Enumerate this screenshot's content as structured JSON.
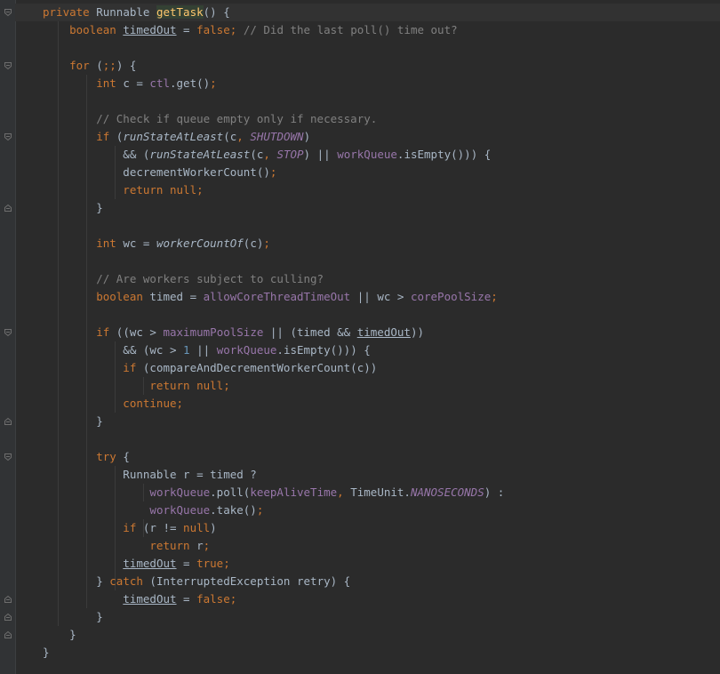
{
  "editor": {
    "lines": [
      [
        {
          "t": "private",
          "c": "kw"
        },
        {
          "t": " Runnable "
        },
        {
          "t": "getTask",
          "c": "fn hl"
        },
        {
          "t": "() {"
        }
      ],
      [
        {
          "t": "    boolean ",
          "c": "kw"
        },
        {
          "t": "timedOut",
          "c": "ul"
        },
        {
          "t": " = "
        },
        {
          "t": "false",
          "c": "kw"
        },
        {
          "t": "; ",
          "c": "kw"
        },
        {
          "t": "// Did the last poll() time out?",
          "c": "cm"
        }
      ],
      [],
      [
        {
          "t": "    for ",
          "c": "kw"
        },
        {
          "t": "("
        },
        {
          "t": ";;",
          "c": "kw"
        },
        {
          "t": ") {"
        }
      ],
      [
        {
          "t": "        int ",
          "c": "kw"
        },
        {
          "t": "c = "
        },
        {
          "t": "ctl",
          "c": "fld"
        },
        {
          "t": ".get()"
        },
        {
          "t": ";",
          "c": "kw"
        }
      ],
      [],
      [
        {
          "t": "        // Check if queue empty only if necessary.",
          "c": "cm"
        }
      ],
      [
        {
          "t": "        if ",
          "c": "kw"
        },
        {
          "t": "("
        },
        {
          "t": "runStateAtLeast",
          "c": "st"
        },
        {
          "t": "(c"
        },
        {
          "t": ", ",
          "c": "kw"
        },
        {
          "t": "SHUTDOWN",
          "c": "cfld"
        },
        {
          "t": ")"
        }
      ],
      [
        {
          "t": "            && ("
        },
        {
          "t": "runStateAtLeast",
          "c": "st"
        },
        {
          "t": "(c"
        },
        {
          "t": ", ",
          "c": "kw"
        },
        {
          "t": "STOP",
          "c": "cfld"
        },
        {
          "t": ") || "
        },
        {
          "t": "workQueue",
          "c": "fld"
        },
        {
          "t": ".isEmpty())) {"
        }
      ],
      [
        {
          "t": "            decrementWorkerCount()"
        },
        {
          "t": ";",
          "c": "kw"
        }
      ],
      [
        {
          "t": "            return null;",
          "c": "kw"
        }
      ],
      [
        {
          "t": "        }"
        }
      ],
      [],
      [
        {
          "t": "        int ",
          "c": "kw"
        },
        {
          "t": "wc = "
        },
        {
          "t": "workerCountOf",
          "c": "st"
        },
        {
          "t": "(c)"
        },
        {
          "t": ";",
          "c": "kw"
        }
      ],
      [],
      [
        {
          "t": "        // Are workers subject to culling?",
          "c": "cm"
        }
      ],
      [
        {
          "t": "        boolean ",
          "c": "kw"
        },
        {
          "t": "timed = "
        },
        {
          "t": "allowCoreThreadTimeOut",
          "c": "fld"
        },
        {
          "t": " || wc > "
        },
        {
          "t": "corePoolSize",
          "c": "fld"
        },
        {
          "t": ";",
          "c": "kw"
        }
      ],
      [],
      [
        {
          "t": "        if ",
          "c": "kw"
        },
        {
          "t": "((wc > "
        },
        {
          "t": "maximumPoolSize",
          "c": "fld"
        },
        {
          "t": " || (timed && "
        },
        {
          "t": "timedOut",
          "c": "ul"
        },
        {
          "t": "))"
        }
      ],
      [
        {
          "t": "            && (wc > "
        },
        {
          "t": "1",
          "c": "num"
        },
        {
          "t": " || "
        },
        {
          "t": "workQueue",
          "c": "fld"
        },
        {
          "t": ".isEmpty())) {"
        }
      ],
      [
        {
          "t": "            if ",
          "c": "kw"
        },
        {
          "t": "(compareAndDecrementWorkerCount(c))"
        }
      ],
      [
        {
          "t": "                return null;",
          "c": "kw"
        }
      ],
      [
        {
          "t": "            continue;",
          "c": "kw"
        }
      ],
      [
        {
          "t": "        }"
        }
      ],
      [],
      [
        {
          "t": "        try ",
          "c": "kw"
        },
        {
          "t": "{"
        }
      ],
      [
        {
          "t": "            Runnable r = timed ?"
        }
      ],
      [
        {
          "t": "                "
        },
        {
          "t": "workQueue",
          "c": "fld"
        },
        {
          "t": ".poll("
        },
        {
          "t": "keepAliveTime",
          "c": "fld"
        },
        {
          "t": ", ",
          "c": "kw"
        },
        {
          "t": "TimeUnit."
        },
        {
          "t": "NANOSECONDS",
          "c": "cfld"
        },
        {
          "t": ") :"
        }
      ],
      [
        {
          "t": "                "
        },
        {
          "t": "workQueue",
          "c": "fld"
        },
        {
          "t": ".take()"
        },
        {
          "t": ";",
          "c": "kw"
        }
      ],
      [
        {
          "t": "            if ",
          "c": "kw"
        },
        {
          "t": "(r != "
        },
        {
          "t": "null",
          "c": "kw"
        },
        {
          "t": ")"
        }
      ],
      [
        {
          "t": "                return ",
          "c": "kw"
        },
        {
          "t": "r"
        },
        {
          "t": ";",
          "c": "kw"
        }
      ],
      [
        {
          "t": "            "
        },
        {
          "t": "timedOut",
          "c": "ul"
        },
        {
          "t": " = "
        },
        {
          "t": "true;",
          "c": "kw"
        }
      ],
      [
        {
          "t": "        } "
        },
        {
          "t": "catch ",
          "c": "kw"
        },
        {
          "t": "(InterruptedException retry) {"
        }
      ],
      [
        {
          "t": "            "
        },
        {
          "t": "timedOut",
          "c": "ul"
        },
        {
          "t": " = "
        },
        {
          "t": "false;",
          "c": "kw"
        }
      ],
      [
        {
          "t": "        }"
        }
      ],
      [
        {
          "t": "    }"
        }
      ],
      [
        {
          "t": "}"
        }
      ]
    ],
    "fold_markers": {
      "open": [
        0,
        3,
        7,
        18,
        25
      ],
      "close": [
        11,
        23,
        33,
        34,
        35
      ]
    }
  }
}
